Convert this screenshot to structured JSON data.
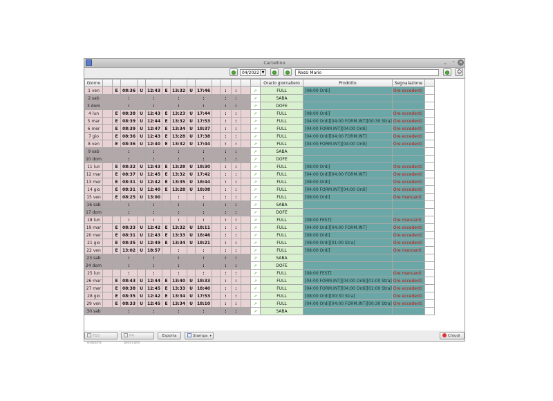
{
  "window": {
    "title": "Cartellino"
  },
  "toolbar": {
    "month": "04/2022",
    "person": "Rossi Mario"
  },
  "table": {
    "headers": [
      "Giorno",
      "",
      "",
      "",
      "",
      "",
      "",
      "",
      "",
      "",
      "",
      "",
      "",
      "",
      "",
      "Orario giornaliero",
      "Prodotto",
      "Segnalazione",
      ""
    ],
    "rows": [
      {
        "day": "1 ven",
        "we": false,
        "t": [
          "E",
          "08:36",
          "U",
          "12:43",
          "E",
          "13:32",
          "U",
          "17:46",
          "",
          ":",
          ":"
        ],
        "orario": "FULL",
        "prodotto": "[08:00 Ordi]",
        "segn": "Ore eccedenti"
      },
      {
        "day": "2 sab",
        "we": true,
        "t": [
          "",
          ":",
          "",
          ":",
          "",
          ":",
          "",
          ":",
          "",
          ":",
          ":"
        ],
        "orario": "SABA",
        "prodotto": "",
        "segn": ""
      },
      {
        "day": "3 dom",
        "we": true,
        "t": [
          "",
          ":",
          "",
          ":",
          "",
          ":",
          "",
          ":",
          "",
          ":",
          ":"
        ],
        "orario": "DOFE",
        "prodotto": "",
        "segn": ""
      },
      {
        "day": "4 lun",
        "we": false,
        "t": [
          "E",
          "08:38",
          "U",
          "12:43",
          "E",
          "13:23",
          "U",
          "17:44",
          "",
          ":",
          ":"
        ],
        "orario": "FULL",
        "prodotto": "[08:00 Ordi]",
        "segn": "Ore eccedenti"
      },
      {
        "day": "5 mar",
        "we": false,
        "t": [
          "E",
          "08:39",
          "U",
          "12:44",
          "E",
          "13:32",
          "U",
          "17:53",
          "",
          ":",
          ":"
        ],
        "orario": "FULL",
        "prodotto": "[04:00 Ordi][04:00 FORM.INT][00:30 Stra]",
        "segn": "Ore eccedenti"
      },
      {
        "day": "6 mer",
        "we": false,
        "t": [
          "E",
          "08:39",
          "U",
          "12:47",
          "E",
          "13:34",
          "U",
          "18:37",
          "",
          ":",
          ":"
        ],
        "orario": "FULL",
        "prodotto": "[04:00 FORM.INT][04:00 Ordi]",
        "segn": "Ore eccedenti"
      },
      {
        "day": "7 gio",
        "we": false,
        "t": [
          "E",
          "08:36",
          "U",
          "12:43",
          "E",
          "13:28",
          "U",
          "17:38",
          "",
          ":",
          ":"
        ],
        "orario": "FULL",
        "prodotto": "[04:00 Ordi][04:00 FORM.INT]",
        "segn": "Ore eccedenti"
      },
      {
        "day": "8 ven",
        "we": false,
        "t": [
          "E",
          "08:36",
          "U",
          "12:40",
          "E",
          "13:32",
          "U",
          "17:44",
          "",
          ":",
          ":"
        ],
        "orario": "FULL",
        "prodotto": "[04:00 FORM.INT][04:00 Ordi]",
        "segn": "Ore eccedenti"
      },
      {
        "day": "9 sab",
        "we": true,
        "t": [
          "",
          ":",
          "",
          ":",
          "",
          ":",
          "",
          ":",
          "",
          ":",
          ":"
        ],
        "orario": "SABA",
        "prodotto": "",
        "segn": ""
      },
      {
        "day": "10 dom",
        "we": true,
        "t": [
          "",
          ":",
          "",
          ":",
          "",
          ":",
          "",
          ":",
          "",
          ":",
          ":"
        ],
        "orario": "DOFE",
        "prodotto": "",
        "segn": ""
      },
      {
        "day": "11 lun",
        "we": false,
        "t": [
          "E",
          "08:32",
          "U",
          "12:43",
          "E",
          "13:28",
          "U",
          "18:30",
          "",
          ":",
          ":"
        ],
        "orario": "FULL",
        "prodotto": "[08:00 Ordi]",
        "segn": "Ore eccedenti"
      },
      {
        "day": "12 mar",
        "we": false,
        "t": [
          "E",
          "08:37",
          "U",
          "12:45",
          "E",
          "13:32",
          "U",
          "17:42",
          "",
          ":",
          ":"
        ],
        "orario": "FULL",
        "prodotto": "[04:00 Ordi][04:00 FORM.INT]",
        "segn": "Ore eccedenti"
      },
      {
        "day": "13 mer",
        "we": false,
        "t": [
          "E",
          "08:31",
          "U",
          "12:42",
          "E",
          "13:35",
          "U",
          "18:44",
          "",
          ":",
          ":"
        ],
        "orario": "FULL",
        "prodotto": "[08:00 Ordi]",
        "segn": "Ore eccedenti"
      },
      {
        "day": "14 gio",
        "we": false,
        "t": [
          "E",
          "08:31",
          "U",
          "12:40",
          "E",
          "13:28",
          "U",
          "18:08",
          "",
          ":",
          ":"
        ],
        "orario": "FULL",
        "prodotto": "[04:00 FORM.INT][04:00 Ordi]",
        "segn": "Ore eccedenti"
      },
      {
        "day": "15 ven",
        "we": false,
        "t": [
          "E",
          "08:25",
          "U",
          "13:00",
          "",
          ":",
          "",
          ":",
          "",
          ":",
          ":"
        ],
        "orario": "FULL",
        "prodotto": "[08:00 Ordi]",
        "segn": "Ore mancanti"
      },
      {
        "day": "16 sab",
        "we": true,
        "t": [
          "",
          ":",
          "",
          ":",
          "",
          ":",
          "",
          ":",
          "",
          ":",
          ":"
        ],
        "orario": "SABA",
        "prodotto": "",
        "segn": ""
      },
      {
        "day": "17 dom",
        "we": true,
        "t": [
          "",
          ":",
          "",
          ":",
          "",
          ":",
          "",
          ":",
          "",
          ":",
          ":"
        ],
        "orario": "DOFE",
        "prodotto": "",
        "segn": ""
      },
      {
        "day": "18 lun",
        "we": false,
        "t": [
          "",
          ":",
          "",
          ":",
          "",
          ":",
          "",
          ":",
          "",
          ":",
          ":"
        ],
        "orario": "FULL",
        "prodotto": "[08:00 FEST]",
        "segn": "Ore mancanti"
      },
      {
        "day": "19 mar",
        "we": false,
        "t": [
          "E",
          "08:33",
          "U",
          "12:42",
          "E",
          "13:32",
          "U",
          "18:11",
          "",
          ":",
          ":"
        ],
        "orario": "FULL",
        "prodotto": "[04:00 Ordi][04:00 FORM.INT]",
        "segn": "Ore eccedenti"
      },
      {
        "day": "20 mer",
        "we": false,
        "t": [
          "E",
          "08:31",
          "U",
          "12:43",
          "E",
          "13:33",
          "U",
          "18:46",
          "",
          ":",
          ":"
        ],
        "orario": "FULL",
        "prodotto": "[08:00 Ordi]",
        "segn": "Ore eccedenti"
      },
      {
        "day": "21 gio",
        "we": false,
        "t": [
          "E",
          "08:35",
          "U",
          "12:49",
          "E",
          "13:34",
          "U",
          "18:21",
          "",
          ":",
          ":"
        ],
        "orario": "FULL",
        "prodotto": "[08:00 Ordi][01:00 Stra]",
        "segn": "Ore eccedenti"
      },
      {
        "day": "22 ven",
        "we": false,
        "t": [
          "E",
          "13:02",
          "U",
          "18:57",
          "",
          ":",
          "",
          ":",
          "",
          ":",
          ":"
        ],
        "orario": "FULL",
        "prodotto": "[08:00 Ordi]",
        "segn": "Ore mancanti"
      },
      {
        "day": "23 sab",
        "we": true,
        "t": [
          "",
          ":",
          "",
          ":",
          "",
          ":",
          "",
          ":",
          "",
          ":",
          ":"
        ],
        "orario": "SABA",
        "prodotto": "",
        "segn": ""
      },
      {
        "day": "24 dom",
        "we": true,
        "t": [
          "",
          ":",
          "",
          ":",
          "",
          ":",
          "",
          ":",
          "",
          ":",
          ":"
        ],
        "orario": "DOFE",
        "prodotto": "",
        "segn": ""
      },
      {
        "day": "25 lun",
        "we": false,
        "t": [
          "",
          ":",
          "",
          ":",
          "",
          ":",
          "",
          ":",
          "",
          ":",
          ":"
        ],
        "orario": "FULL",
        "prodotto": "[08:00 FEST]",
        "segn": "Ore mancanti"
      },
      {
        "day": "26 mar",
        "we": false,
        "t": [
          "E",
          "08:43",
          "U",
          "12:44",
          "E",
          "13:40",
          "U",
          "18:33",
          "",
          ":",
          ":"
        ],
        "orario": "FULL",
        "prodotto": "[04:00 FORM.INT][04:00 Ordi][01:00 Stra]",
        "segn": "Ore eccedenti"
      },
      {
        "day": "27 mer",
        "we": false,
        "t": [
          "E",
          "08:38",
          "U",
          "12:45",
          "E",
          "13:33",
          "U",
          "18:40",
          "",
          ":",
          ":"
        ],
        "orario": "FULL",
        "prodotto": "[04:00 FORM.INT][04:00 Ordi][01:00 Stra]",
        "segn": "Ore eccedenti"
      },
      {
        "day": "28 gio",
        "we": false,
        "t": [
          "E",
          "08:35",
          "U",
          "12:42",
          "E",
          "13:34",
          "U",
          "17:53",
          "",
          ":",
          ":"
        ],
        "orario": "FULL",
        "prodotto": "[08:00 Ordi][00:30 Stra]",
        "segn": "Ore eccedenti"
      },
      {
        "day": "29 ven",
        "we": false,
        "t": [
          "E",
          "08:33",
          "U",
          "12:45",
          "E",
          "13:34",
          "U",
          "18:10",
          "",
          ":",
          ":"
        ],
        "orario": "FULL",
        "prodotto": "[04:00 Ordi][04:00 FORM.INT][00:30 Stra]",
        "segn": "Ore eccedenti"
      },
      {
        "day": "30 sab",
        "we": true,
        "t": [
          "",
          ":",
          "",
          ":",
          "",
          ":",
          "",
          ":",
          "",
          ":",
          ":"
        ],
        "orario": "SABA",
        "prodotto": "",
        "segn": ""
      }
    ]
  },
  "footer": {
    "f10": "F10 elabora",
    "f4": "F4 Bloccato",
    "esporta": "Esporta",
    "stampa": "Stampa",
    "chiudi": "Chiudi"
  },
  "colors": {
    "weekday": "#e8d2d4",
    "weekend": "#b2a8aa",
    "orario": "#d9f1cf",
    "prodotto": "#6aa7a6",
    "alert": "#c40f0f"
  }
}
